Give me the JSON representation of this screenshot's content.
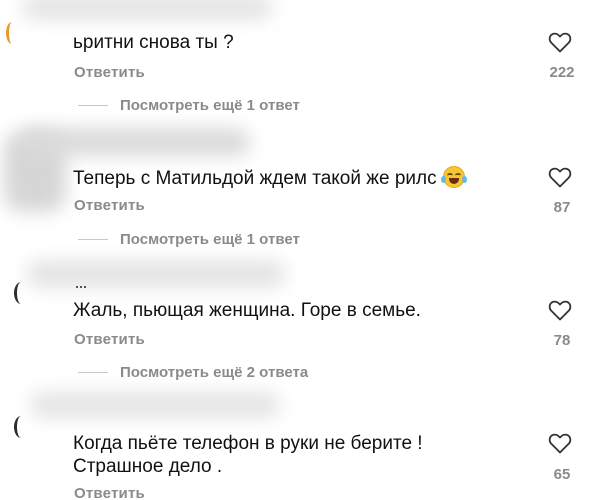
{
  "icons": {
    "like": "heart-outline-icon"
  },
  "colors": {
    "text": "#111111",
    "secondary": "#8a8a8a",
    "divider": "#c9c9c9"
  },
  "comments": [
    {
      "text": "ьритни снова ты ?",
      "reply_label": "Ответить",
      "likes": "222",
      "more_replies": "Посмотреть ещё 1 ответ"
    },
    {
      "text": "Теперь с Матильдой ждем такой же рилс",
      "emoji": "face-with-tears-of-joy",
      "reply_label": "Ответить",
      "likes": "87",
      "more_replies": "Посмотреть ещё 1 ответ"
    },
    {
      "text": "Жаль, пьющая женщина. Горе в семье.",
      "reply_label": "Ответить",
      "likes": "78",
      "more_replies": "Посмотреть ещё 2 ответа"
    },
    {
      "text_line1": "Когда пьёте телефон в руки не берите !",
      "text_line2": "Страшное дело .",
      "reply_label": "Ответить",
      "likes": "65"
    }
  ]
}
